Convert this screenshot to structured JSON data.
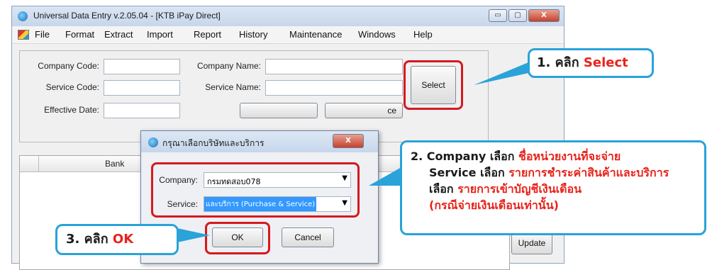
{
  "window": {
    "title": "Universal Data Entry v.2.05.04 - [KTB iPay Direct]",
    "min_symbol": "▭",
    "max_symbol": "▢",
    "close_symbol": "X"
  },
  "menu": [
    "File",
    "Format",
    "Extract",
    "Import",
    "Report",
    "History",
    "Maintenance",
    "Windows",
    "Help"
  ],
  "form": {
    "company_code_label": "Company Code:",
    "company_name_label": "Company Name:",
    "service_code_label": "Service Code:",
    "service_name_label": "Service Name:",
    "effective_date_label": "Effective Date:",
    "select_button": "Select",
    "partial_button_text": "ce"
  },
  "grid": {
    "bank_header": "Bank",
    "update_button": "Update"
  },
  "dialog": {
    "title": "กรุณาเลือกบริษัทและบริการ",
    "close_symbol": "X",
    "company_label": "Company:",
    "company_value": "กรมทดสอบ078",
    "service_label": "Service:",
    "service_value": "และบริการ (Purchase & Service)",
    "ok_button": "OK",
    "cancel_button": "Cancel"
  },
  "callouts": {
    "step1_prefix": "1. คลิก",
    "step1_highlight": "Select",
    "step2_line1_prefix": "2. Company เลือก",
    "step2_line1_highlight": "ชื่อหน่วยงานที่จะจ่าย",
    "step2_line2_prefix": "Service เลือก",
    "step2_line2_highlight": "รายการชำระค่าสินค้าและบริการ",
    "step2_line3_prefix": "เลือก",
    "step2_line3_highlight": "รายการเข้าบัญชีเงินเดือน",
    "step2_line4_highlight": "(กรณีจ่ายเงินเดือนเท่านั้น)",
    "step3_prefix": "3. คลิก",
    "step3_highlight": "OK"
  },
  "colors": {
    "highlight_red": "#e8231b",
    "callout_border": "#29a3d9",
    "focus_box": "#d6191f"
  }
}
